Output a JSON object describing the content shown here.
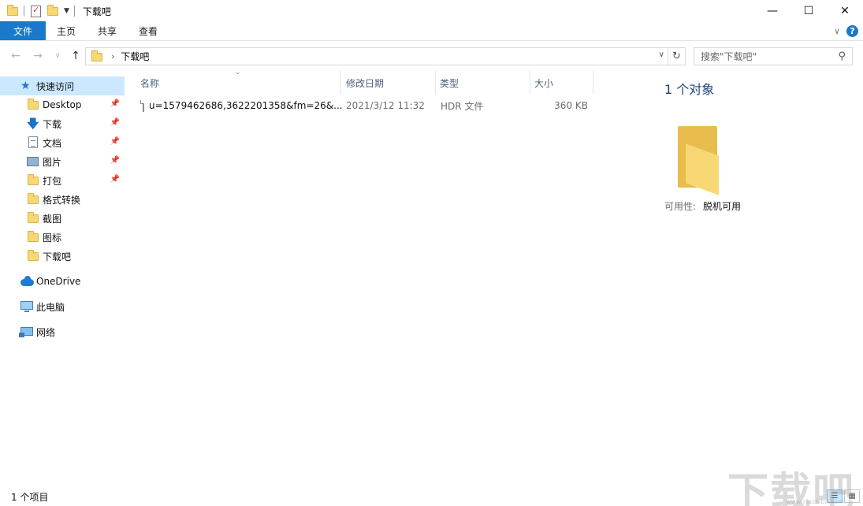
{
  "window": {
    "title": "下载吧"
  },
  "controls": {
    "minimize": "—",
    "maximize": "☐",
    "close": "✕"
  },
  "ribbon": {
    "tabs": [
      {
        "label": "文件",
        "active": true
      },
      {
        "label": "主页"
      },
      {
        "label": "共享"
      },
      {
        "label": "查看"
      }
    ],
    "expand_icon": "chevron-down-icon",
    "help_glyph": "?"
  },
  "address": {
    "path": "下载吧",
    "search_placeholder": "搜索\"下载吧\""
  },
  "nav": {
    "quick_access": "快速访问",
    "items": [
      {
        "label": "Desktop",
        "icon": "folder-icon",
        "pinned": true
      },
      {
        "label": "下载",
        "icon": "download-icon",
        "pinned": true
      },
      {
        "label": "文档",
        "icon": "document-icon",
        "pinned": true
      },
      {
        "label": "图片",
        "icon": "pictures-icon",
        "pinned": true
      },
      {
        "label": "打包",
        "icon": "folder-icon",
        "pinned": true
      },
      {
        "label": "格式转换",
        "icon": "folder-icon",
        "pinned": false
      },
      {
        "label": "截图",
        "icon": "folder-icon",
        "pinned": false
      },
      {
        "label": "图标",
        "icon": "folder-icon",
        "pinned": false
      },
      {
        "label": "下载吧",
        "icon": "folder-icon",
        "pinned": false
      }
    ],
    "onedrive": "OneDrive",
    "this_pc": "此电脑",
    "network": "网络"
  },
  "filelist": {
    "columns": [
      "名称",
      "修改日期",
      "类型",
      "大小"
    ],
    "rows": [
      {
        "name": "u=1579462686,3622201358&fm=26&...",
        "modified": "2021/3/12 11:32",
        "type": "HDR 文件",
        "size": "360 KB"
      }
    ]
  },
  "details": {
    "count": "1 个对象",
    "availability_label": "可用性:",
    "availability_value": "脱机可用"
  },
  "status": {
    "items": "1 个项目"
  },
  "watermark": {
    "text": "下载吧",
    "sub": "www.xiazaiba.com"
  },
  "colors": {
    "accent": "#1979ca",
    "selection": "#cce8ff",
    "folder": "#f8d775"
  }
}
